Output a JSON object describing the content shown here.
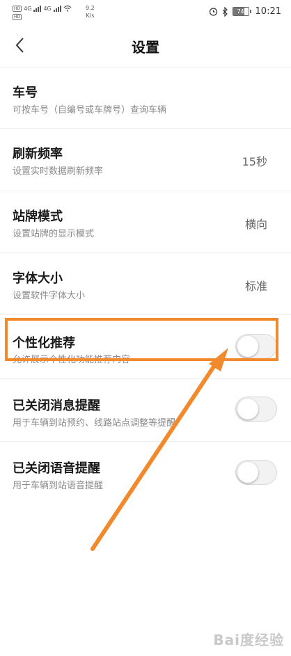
{
  "status_bar": {
    "carrier_row1_badge": "HD",
    "carrier_row1_net": "4G",
    "carrier_row2_badge": "HD",
    "carrier_row2_net": "4G",
    "speed_value": "9.2",
    "speed_unit": "K/s",
    "battery_level": "74",
    "time": "10:21"
  },
  "header": {
    "title": "设置"
  },
  "settings": [
    {
      "title": "车号",
      "subtitle": "可按车号（自编号或车牌号）查询车辆"
    },
    {
      "title": "刷新频率",
      "subtitle": "设置实时数据刷新频率",
      "value": "15秒"
    },
    {
      "title": "站牌模式",
      "subtitle": "设置站牌的显示模式",
      "value": "横向"
    },
    {
      "title": "字体大小",
      "subtitle": "设置软件字体大小",
      "value": "标准"
    },
    {
      "title": "个性化推荐",
      "subtitle": "允许展示个性化功能推荐内容",
      "toggle_on": false
    },
    {
      "title": "已关闭消息提醒",
      "subtitle": "用于车辆到站预约、线路站点调整等提醒",
      "toggle_on": false
    },
    {
      "title": "已关闭语音提醒",
      "subtitle": "用于车辆到站语音提醒",
      "toggle_on": false
    }
  ],
  "watermark": "Bai度经验",
  "colors": {
    "highlight": "#f18a2c",
    "accent_arrow": "#f18a2c"
  }
}
